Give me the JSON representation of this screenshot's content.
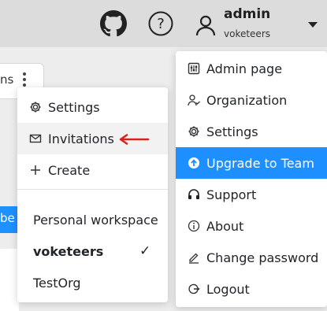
{
  "header": {
    "github_icon": "github-icon",
    "help_icon": "help-circle-icon",
    "user_icon": "user-icon",
    "username": "admin",
    "workspace": "voketeers"
  },
  "background": {
    "card_text": "ns",
    "blue_button_text": "be"
  },
  "workspace_menu": {
    "items": [
      {
        "label": "Settings",
        "icon": "gear-icon"
      },
      {
        "label": "Invitations",
        "icon": "envelope-icon"
      },
      {
        "label": "Create",
        "icon": "plus-icon"
      }
    ],
    "workspaces": [
      {
        "label": "Personal workspace",
        "selected": false
      },
      {
        "label": "voketeers",
        "selected": true
      },
      {
        "label": "TestOrg",
        "selected": false
      }
    ],
    "check_glyph": "✓",
    "annotation_color": "#d9221c"
  },
  "account_menu": {
    "items": [
      {
        "label": "Admin page",
        "icon": "admin-page-icon"
      },
      {
        "label": "Organization",
        "icon": "organization-icon",
        "has_submenu": true
      },
      {
        "label": "Settings",
        "icon": "gear-icon"
      },
      {
        "label": "Upgrade to Team",
        "icon": "upgrade-arrow-icon",
        "active": true
      },
      {
        "label": "Support",
        "icon": "headset-icon"
      },
      {
        "label": "About",
        "icon": "info-icon"
      },
      {
        "label": "Change password",
        "icon": "pencil-icon"
      },
      {
        "label": "Logout",
        "icon": "logout-icon"
      }
    ],
    "accent_color": "#1e8ffe"
  }
}
